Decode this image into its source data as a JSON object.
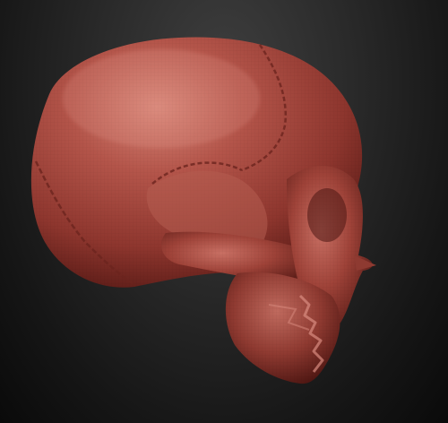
{
  "scene": {
    "subject": "sculpted-skull-model",
    "colors": {
      "background_top": "#3f3f3f",
      "background_bottom": "#0a0a0a",
      "material_base": "#a8463c",
      "material_highlight": "#d78577",
      "material_shadow": "#5e1d18"
    }
  }
}
